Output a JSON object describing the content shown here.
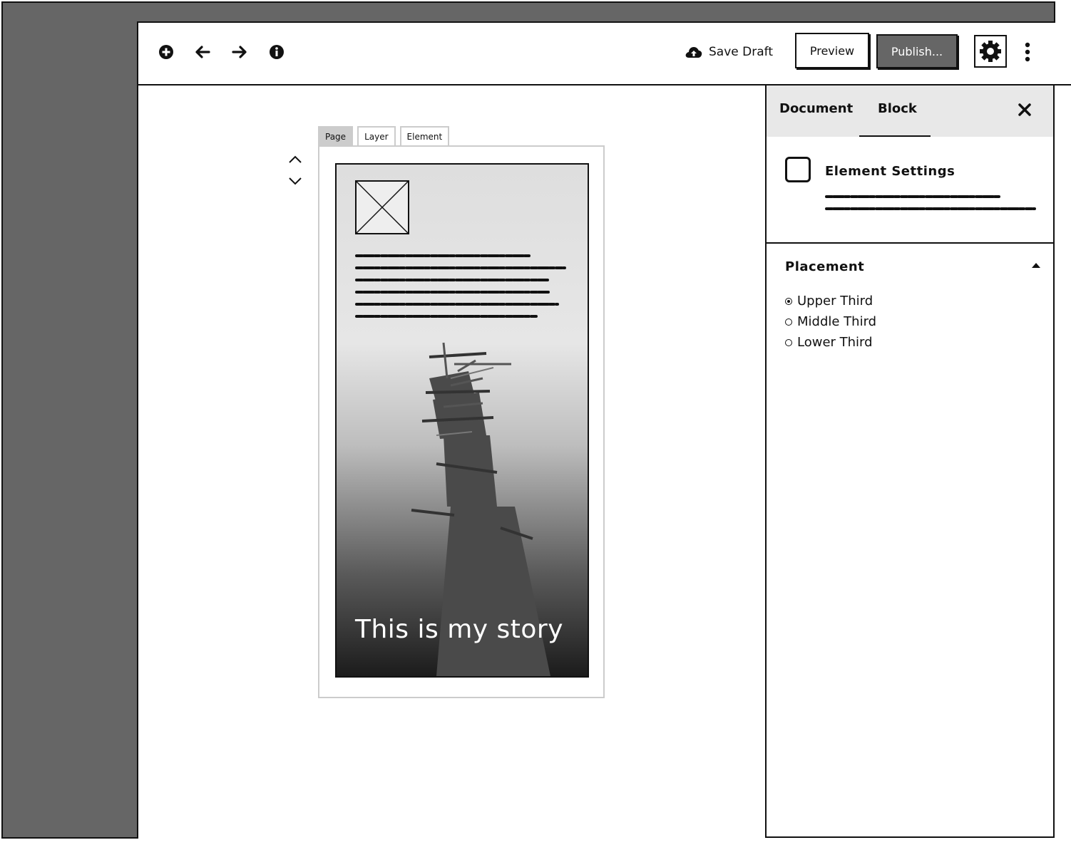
{
  "toolbar": {
    "icons": [
      "add-icon",
      "undo-icon",
      "redo-icon",
      "info-icon"
    ],
    "save_draft_label": "Save Draft",
    "preview_label": "Preview",
    "publish_label": "Publish...",
    "settings_icon": "gear-icon",
    "more_icon": "more-vertical-icon"
  },
  "editor": {
    "stepper_icons": [
      "chevron-up-icon",
      "chevron-down-icon"
    ],
    "tabs": [
      {
        "label": "Page",
        "active": true
      },
      {
        "label": "Layer",
        "active": false
      },
      {
        "label": "Element",
        "active": false
      }
    ],
    "story_title": "This is my story"
  },
  "panel": {
    "tabs": [
      {
        "label": "Document",
        "active": false
      },
      {
        "label": "Block",
        "active": true
      }
    ],
    "close_icon": "close-icon",
    "settings_title": "Element Settings",
    "placement": {
      "title": "Placement",
      "options": [
        {
          "label": "Upper Third",
          "selected": true
        },
        {
          "label": "Middle Third",
          "selected": false
        },
        {
          "label": "Lower Third",
          "selected": false
        }
      ]
    }
  },
  "colors": {
    "chrome_gray": "#666666",
    "border": "#111111",
    "panel_header": "#e8e8e8",
    "tab_active": "#cccccc"
  }
}
